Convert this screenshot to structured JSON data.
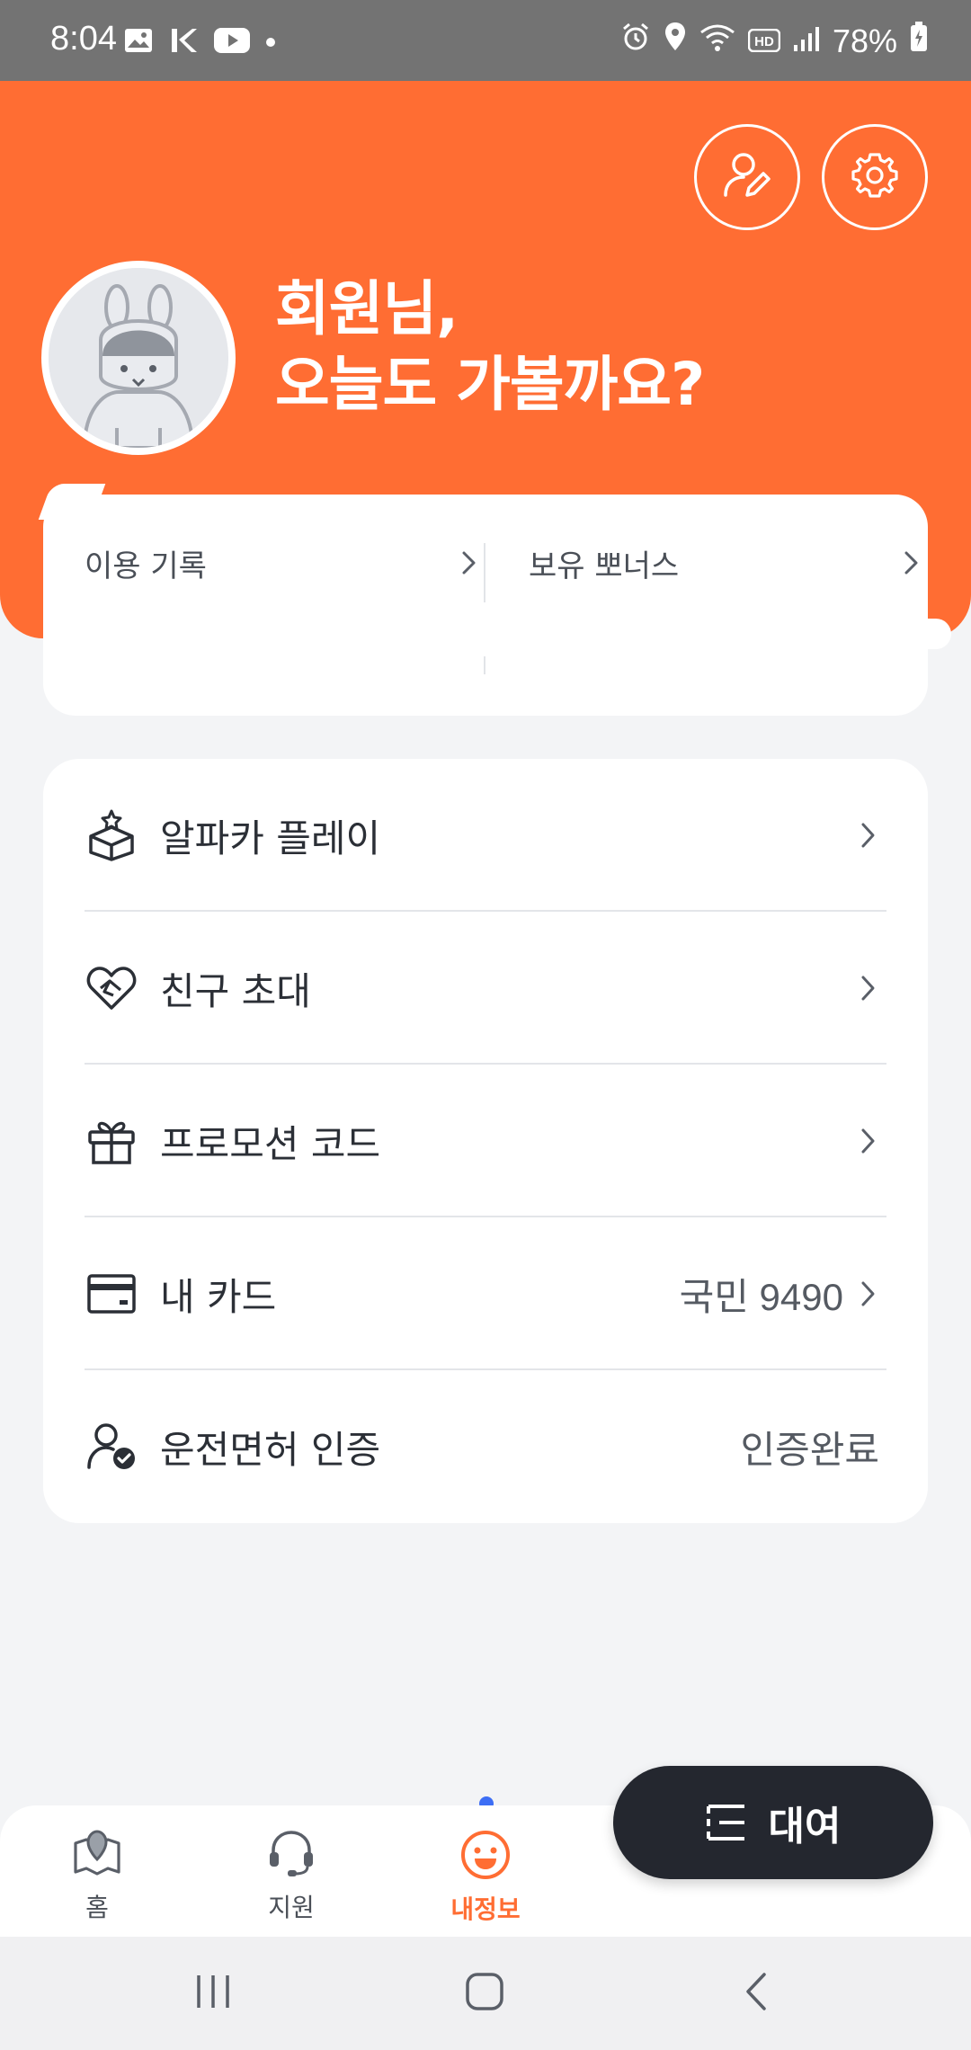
{
  "status_bar": {
    "time": "8:04",
    "battery": "78%",
    "icons_left": [
      "gallery-icon",
      "vpn-k-icon",
      "youtube-icon",
      "dot-icon"
    ],
    "icons_right": [
      "alarm-icon",
      "location-icon",
      "wifi-icon",
      "hd-icon",
      "signal-icon",
      "battery-charging-icon"
    ]
  },
  "header": {
    "greeting_line1": "회원님,",
    "greeting_line2": "오늘도 가볼까요?",
    "bg_color": "#ff6d33"
  },
  "summary": {
    "usage_label": "이용 기록",
    "bonus_label": "보유 뽀너스"
  },
  "menu": {
    "items": [
      {
        "label": "알파카 플레이",
        "value": "",
        "icon": "play-box-icon"
      },
      {
        "label": "친구 초대",
        "value": "",
        "icon": "heart-handshake-icon"
      },
      {
        "label": "프로모션 코드",
        "value": "",
        "icon": "gift-icon"
      },
      {
        "label": "내 카드",
        "value": "국민 9490",
        "icon": "card-icon"
      },
      {
        "label": "운전면허 인증",
        "value": "인증완료",
        "icon": "license-verified-icon"
      }
    ]
  },
  "bottom_nav": {
    "home": "홈",
    "support": "지원",
    "me": "내정보",
    "rent_button": "대여",
    "active_color": "#ff6d33",
    "dot_color": "#3d6ef5"
  }
}
